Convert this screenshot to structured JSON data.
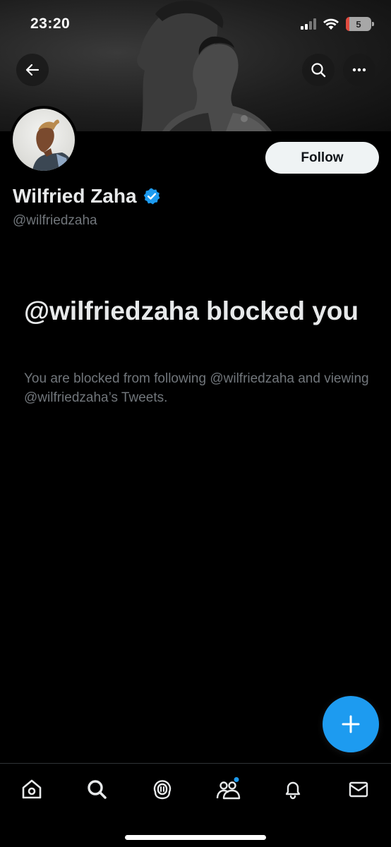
{
  "status_bar": {
    "time": "23:20",
    "battery_level": "5"
  },
  "header": {
    "back_icon": "arrow-left-icon",
    "search_icon": "search-icon",
    "more_icon": "more-horizontal-icon"
  },
  "profile": {
    "display_name": "Wilfried Zaha",
    "handle": "@wilfriedzaha",
    "verified": true,
    "follow_label": "Follow"
  },
  "blocked": {
    "title": "@wilfriedzaha blocked you",
    "description": "You are blocked from following @wilfriedzaha and viewing @wilfriedzaha’s Tweets."
  },
  "fab": {
    "icon": "plus-icon"
  },
  "tabbar": {
    "items": [
      {
        "icon": "home-icon"
      },
      {
        "icon": "search-icon"
      },
      {
        "icon": "spaces-icon"
      },
      {
        "icon": "communities-icon",
        "has_notification_dot": true
      },
      {
        "icon": "bell-icon"
      },
      {
        "icon": "mail-icon"
      }
    ]
  },
  "colors": {
    "background": "#000000",
    "accent": "#1d9bf0",
    "text_primary": "#e7e9ea",
    "text_secondary": "#71767b",
    "follow_button_bg": "#eff3f4"
  }
}
